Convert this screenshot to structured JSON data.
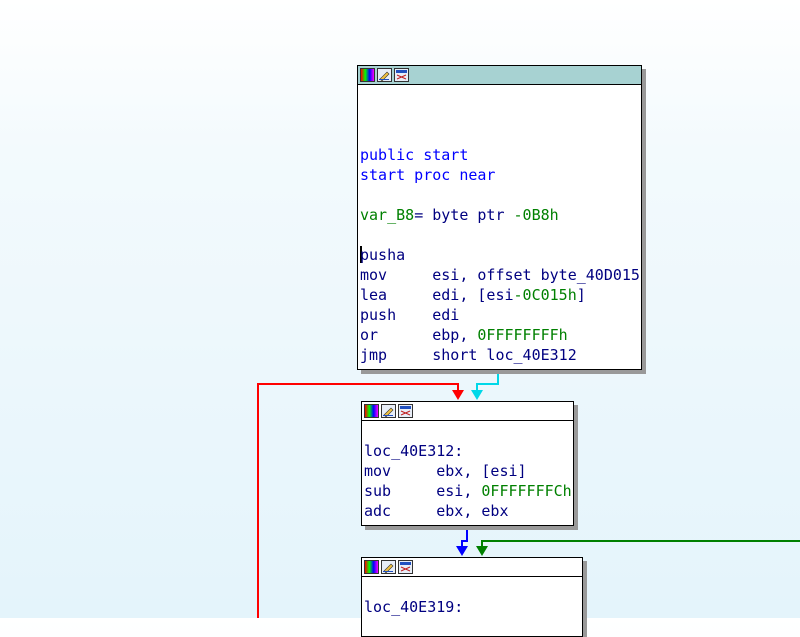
{
  "colors": {
    "edge_red": "#ff0000",
    "edge_cyan": "#00d8e8",
    "edge_blue": "#0000ff",
    "edge_green": "#008000",
    "titlebar_active": "#a7d2d2"
  },
  "nodes": [
    {
      "name": "block-start",
      "active": true,
      "icons": [
        "color-palette-icon",
        "edit-pencil-icon",
        "graph-view-icon"
      ],
      "lines": [
        {
          "text": ""
        },
        {
          "text": ""
        },
        {
          "text": ""
        },
        {
          "text": "public start",
          "style": "kw"
        },
        {
          "text": "start proc near",
          "style": "kw"
        },
        {
          "text": ""
        },
        {
          "parts": [
            {
              "text": "var_B8",
              "style": "var"
            },
            {
              "text": "= byte ptr ",
              "style": "op"
            },
            {
              "text": "-0B8h",
              "style": "num"
            }
          ]
        },
        {
          "text": ""
        },
        {
          "parts": [
            {
              "text": "pusha",
              "style": "op"
            }
          ],
          "cursor": true
        },
        {
          "parts": [
            {
              "text": "mov     esi, offset byte_40D015",
              "style": "op"
            }
          ]
        },
        {
          "parts": [
            {
              "text": "lea     edi, [esi",
              "style": "op"
            },
            {
              "text": "-0C015h",
              "style": "num"
            },
            {
              "text": "]",
              "style": "op"
            }
          ]
        },
        {
          "parts": [
            {
              "text": "push    edi",
              "style": "op"
            }
          ]
        },
        {
          "parts": [
            {
              "text": "or      ebp, ",
              "style": "op"
            },
            {
              "text": "0FFFFFFFFh",
              "style": "num"
            }
          ]
        },
        {
          "parts": [
            {
              "text": "jmp     short loc_40E312",
              "style": "op"
            }
          ]
        }
      ]
    },
    {
      "name": "block-loc-40E312",
      "active": false,
      "icons": [
        "color-palette-icon",
        "edit-pencil-icon",
        "graph-view-icon"
      ],
      "lines": [
        {
          "text": ""
        },
        {
          "parts": [
            {
              "text": "loc_40E312:",
              "style": "op"
            }
          ]
        },
        {
          "parts": [
            {
              "text": "mov     ebx, [esi]",
              "style": "op"
            }
          ]
        },
        {
          "parts": [
            {
              "text": "sub     esi, ",
              "style": "op"
            },
            {
              "text": "0FFFFFFFCh",
              "style": "num"
            }
          ]
        },
        {
          "parts": [
            {
              "text": "adc     ebx, ebx",
              "style": "op"
            }
          ]
        }
      ]
    },
    {
      "name": "block-loc-40E319",
      "active": false,
      "icons": [
        "color-palette-icon",
        "edit-pencil-icon",
        "graph-view-icon"
      ],
      "lines": [
        {
          "text": ""
        },
        {
          "parts": [
            {
              "text": "loc_40E319:",
              "style": "op"
            }
          ]
        }
      ]
    }
  ]
}
